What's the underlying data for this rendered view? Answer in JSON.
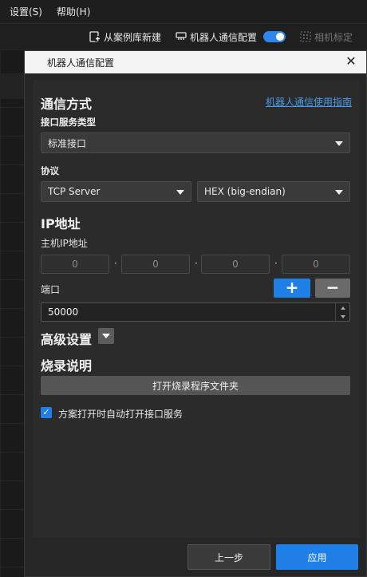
{
  "menubar": {
    "items": [
      "设置(S)",
      "帮助(H)"
    ]
  },
  "toolbar": {
    "new_from_case": "从案例库新建",
    "robot_comm": "机器人通信配置",
    "robot_comm_enabled": true,
    "camera_calib": "相机标定"
  },
  "dialog": {
    "title": "机器人通信配置",
    "section_comm": "通信方式",
    "guide_link": "机器人通信使用指南",
    "iface_type_label": "接口服务类型",
    "iface_type_value": "标准接口",
    "protocol_label": "协议",
    "protocol_value": "TCP Server",
    "format_value": "HEX (big-endian)",
    "ip_section": "IP地址",
    "host_ip_label": "主机IP地址",
    "ip": [
      "0",
      "0",
      "0",
      "0"
    ],
    "ip_sep": "·",
    "port_label": "端口",
    "add_symbol": "+",
    "remove_symbol": "−",
    "port_value": "50000",
    "advanced_label": "高级设置",
    "burn_section": "烧录说明",
    "open_folder_btn": "打开烧录程序文件夹",
    "auto_open_checked": true,
    "auto_open_label": "方案打开时自动打开接口服务",
    "prev_btn": "上一步",
    "apply_btn": "应用"
  },
  "colors": {
    "accent": "#1f7fe6",
    "link": "#4a9be8"
  }
}
